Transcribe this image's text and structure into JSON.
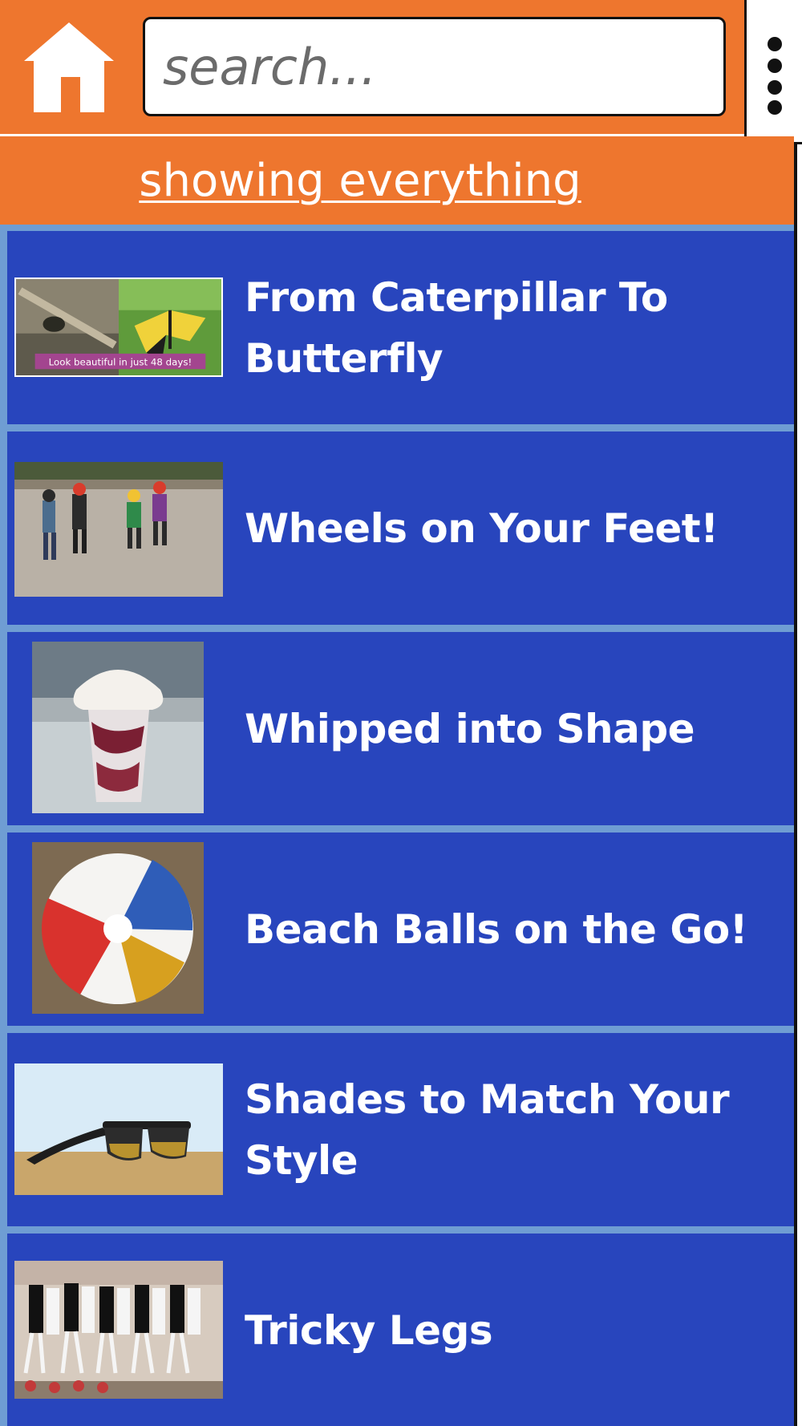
{
  "header": {
    "search_placeholder": "search...",
    "home_icon": "home-icon",
    "menu_icon": "vertical-dots-menu-icon"
  },
  "filter": {
    "label": "showing everything"
  },
  "colors": {
    "orange": "#ee762e",
    "item_blue": "#2845bd",
    "divider_blue": "#6f9dd3",
    "text": "#ffffff"
  },
  "items": [
    {
      "title": "From Caterpillar To Butterfly",
      "thumb_caption": "Look beautiful in just 48 days!"
    },
    {
      "title": "Wheels on Your Feet!"
    },
    {
      "title": "Whipped into Shape"
    },
    {
      "title": "Beach Balls on the Go!"
    },
    {
      "title": "Shades to Match Your Style"
    },
    {
      "title": "Tricky Legs"
    }
  ]
}
